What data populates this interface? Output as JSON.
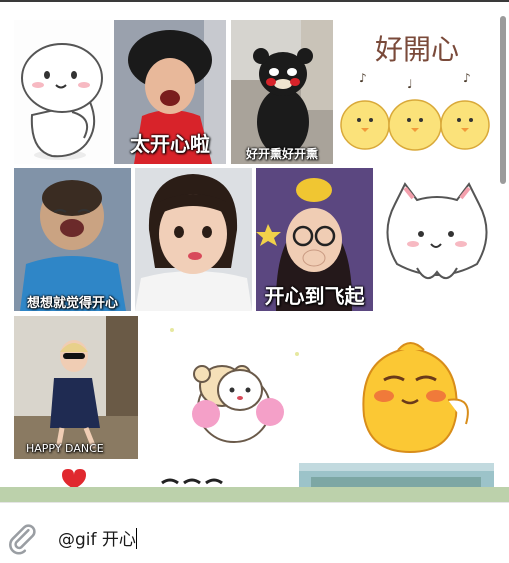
{
  "gifs": [
    {
      "id": "gif-1",
      "caption": ""
    },
    {
      "id": "gif-2",
      "caption": "太开心啦"
    },
    {
      "id": "gif-3",
      "caption": "好开熏好开熏"
    },
    {
      "id": "gif-4",
      "caption": "好開心"
    },
    {
      "id": "gif-5",
      "caption": "想想就觉得开心"
    },
    {
      "id": "gif-6",
      "caption": ""
    },
    {
      "id": "gif-7",
      "caption": "开心到飞起"
    },
    {
      "id": "gif-8",
      "caption": ""
    },
    {
      "id": "gif-9",
      "caption": "HAPPY DANCE"
    },
    {
      "id": "gif-10",
      "caption": ""
    },
    {
      "id": "gif-11",
      "caption": ""
    }
  ],
  "composer": {
    "message_text": "@gif 开心",
    "attach_icon": "paperclip-icon"
  },
  "colors": {
    "chat_background": "#bcd1ab",
    "panel_border": "#3a3a3a"
  }
}
